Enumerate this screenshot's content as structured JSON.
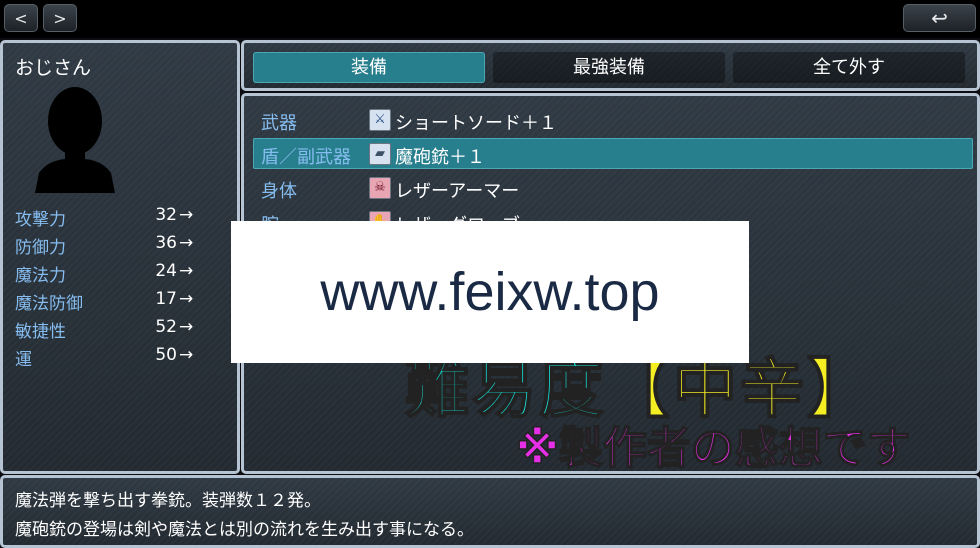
{
  "nav": {
    "prev_label": "<",
    "next_label": ">",
    "back_icon": "↩"
  },
  "status": {
    "actor_name": "おじさん",
    "params": [
      {
        "name": "攻撃力",
        "value": "32",
        "arrow": "→"
      },
      {
        "name": "防御力",
        "value": "36",
        "arrow": "→"
      },
      {
        "name": "魔法力",
        "value": "24",
        "arrow": "→"
      },
      {
        "name": "魔法防御",
        "value": "17",
        "arrow": "→"
      },
      {
        "name": "敏捷性",
        "value": "52",
        "arrow": "→"
      },
      {
        "name": "運",
        "value": "50",
        "arrow": "→"
      }
    ]
  },
  "commands": [
    {
      "label": "装備",
      "selected": true
    },
    {
      "label": "最強装備",
      "selected": false
    },
    {
      "label": "全て外す",
      "selected": false
    }
  ],
  "slots": [
    {
      "slot": "武器",
      "item": "ショートソード＋１",
      "icon": "sword-icon",
      "icon_glyph": "⚔",
      "icon_bg": "#d7e2f0",
      "icon_color": "#2a4f86"
    },
    {
      "slot": "盾／副武器",
      "item": "魔砲銃＋１",
      "icon": "gun-icon",
      "icon_glyph": "▰",
      "icon_bg": "#d7e2f0",
      "icon_color": "#3d5266",
      "selected": true
    },
    {
      "slot": "身体",
      "item": "レザーアーマー",
      "icon": "armor-icon",
      "icon_glyph": "☠",
      "icon_bg": "#e8a6b4",
      "icon_color": "#6b1020"
    },
    {
      "slot": "腕",
      "item": "レザーグローブ",
      "icon": "glove-icon",
      "icon_glyph": "✋",
      "icon_bg": "#e8a6b4",
      "icon_color": "#6b1020"
    }
  ],
  "overlay": {
    "difficulty_a": "難易度",
    "difficulty_b": "【中辛】",
    "impression": "※製作者の感想です",
    "watermark": "www.feixw.top",
    "difficulty_color": "#14e6dc",
    "bracket_color": "#f5ee22",
    "impression_color": "#e62fe6"
  },
  "help": {
    "line1": "魔法弾を撃ち出す拳銃。装弾数１２発。",
    "line2": "魔砲銃の登場は剣や魔法とは別の流れを生み出す事になる。"
  }
}
